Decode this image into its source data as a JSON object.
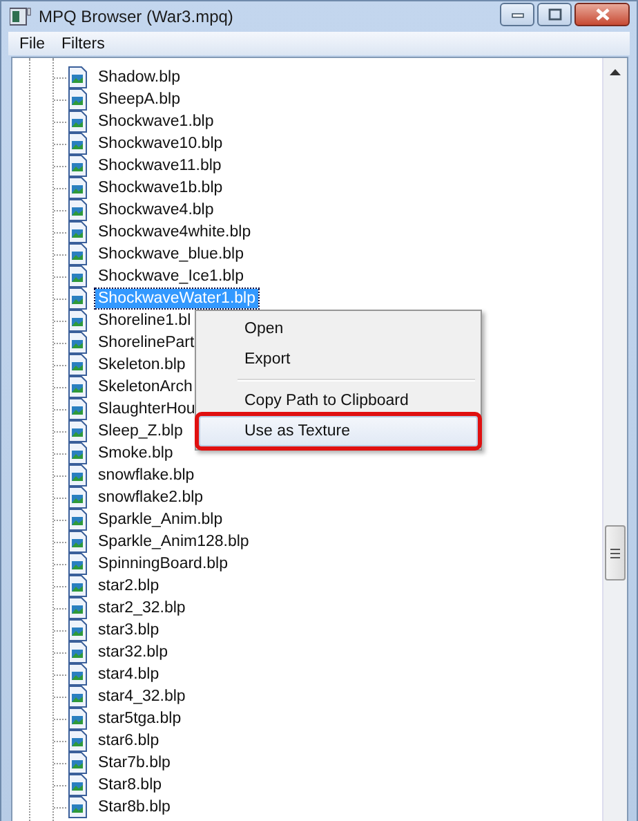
{
  "window": {
    "title": "MPQ Browser (War3.mpq)"
  },
  "menu": [
    "File",
    "Filters"
  ],
  "files": [
    {
      "name": "Shadow.blp",
      "selected": false
    },
    {
      "name": "SheepA.blp",
      "selected": false
    },
    {
      "name": "Shockwave1.blp",
      "selected": false
    },
    {
      "name": "Shockwave10.blp",
      "selected": false
    },
    {
      "name": "Shockwave11.blp",
      "selected": false
    },
    {
      "name": "Shockwave1b.blp",
      "selected": false
    },
    {
      "name": "Shockwave4.blp",
      "selected": false
    },
    {
      "name": "Shockwave4white.blp",
      "selected": false
    },
    {
      "name": "Shockwave_blue.blp",
      "selected": false
    },
    {
      "name": "Shockwave_Ice1.blp",
      "selected": false
    },
    {
      "name": "ShockwaveWater1.blp",
      "selected": true
    },
    {
      "name": "Shoreline1.bl",
      "selected": false
    },
    {
      "name": "ShorelinePart",
      "selected": false
    },
    {
      "name": "Skeleton.blp",
      "selected": false
    },
    {
      "name": "SkeletonArch",
      "selected": false
    },
    {
      "name": "SlaughterHou",
      "selected": false
    },
    {
      "name": "Sleep_Z.blp",
      "selected": false
    },
    {
      "name": "Smoke.blp",
      "selected": false
    },
    {
      "name": "snowflake.blp",
      "selected": false
    },
    {
      "name": "snowflake2.blp",
      "selected": false
    },
    {
      "name": "Sparkle_Anim.blp",
      "selected": false
    },
    {
      "name": "Sparkle_Anim128.blp",
      "selected": false
    },
    {
      "name": "SpinningBoard.blp",
      "selected": false
    },
    {
      "name": "star2.blp",
      "selected": false
    },
    {
      "name": "star2_32.blp",
      "selected": false
    },
    {
      "name": "star3.blp",
      "selected": false
    },
    {
      "name": "star32.blp",
      "selected": false
    },
    {
      "name": "star4.blp",
      "selected": false
    },
    {
      "name": "star4_32.blp",
      "selected": false
    },
    {
      "name": "star5tga.blp",
      "selected": false
    },
    {
      "name": "star6.blp",
      "selected": false
    },
    {
      "name": "Star7b.blp",
      "selected": false
    },
    {
      "name": "Star8.blp",
      "selected": false
    },
    {
      "name": "Star8b.blp",
      "selected": false
    }
  ],
  "context_menu": [
    {
      "label": "Open",
      "separator_before": false,
      "selected": false,
      "outlined": false
    },
    {
      "label": "Export",
      "separator_before": false,
      "selected": false,
      "outlined": false
    },
    {
      "label": "Copy Path to Clipboard",
      "separator_before": true,
      "selected": false,
      "outlined": false
    },
    {
      "label": "Use as Texture",
      "separator_before": false,
      "selected": true,
      "outlined": true
    }
  ]
}
